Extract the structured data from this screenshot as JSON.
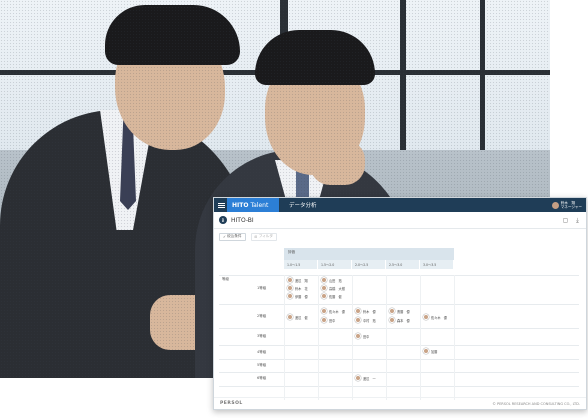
{
  "app": {
    "brand_bold": "HITO",
    "brand_light": "Talent",
    "nav_item": "データ分析",
    "user_name": "鈴木　翔",
    "user_role": "マネージャー"
  },
  "page": {
    "logo_letter": "B",
    "title": "HITO-BI",
    "filter_button": "絞込条件",
    "ghost_button": "フィルタ"
  },
  "grid": {
    "header_group": "評価",
    "columns": [
      "1.0～1.5",
      "1.5～2.0",
      "2.0～2.5",
      "2.5～3.0",
      "3.0～3.5"
    ],
    "row_header": "等級",
    "rows": [
      "1等級",
      "2等級",
      "3等級",
      "4等級",
      "5等級",
      "6等級"
    ],
    "people": [
      {
        "name": "渡辺　翔"
      },
      {
        "name": "鈴木　花"
      },
      {
        "name": "伊藤　優"
      },
      {
        "name": "山田　拓"
      },
      {
        "name": "高橋　大樹"
      },
      {
        "name": "佐藤　健"
      },
      {
        "name": "渡辺　健"
      },
      {
        "name": "佐々木　優"
      },
      {
        "name": "田中"
      },
      {
        "name": "鈴木　優"
      },
      {
        "name": "中村　拓"
      },
      {
        "name": "斎藤　優"
      },
      {
        "name": "森本　優"
      },
      {
        "name": "佐々木　優"
      },
      {
        "name": "田中"
      },
      {
        "name": "渡辺　一"
      },
      {
        "name": "加藤"
      }
    ]
  },
  "footer": {
    "logo": "PERSOL",
    "copyright": "© PERSOL RESEARCH AND CONSULTING CO., LTD."
  }
}
